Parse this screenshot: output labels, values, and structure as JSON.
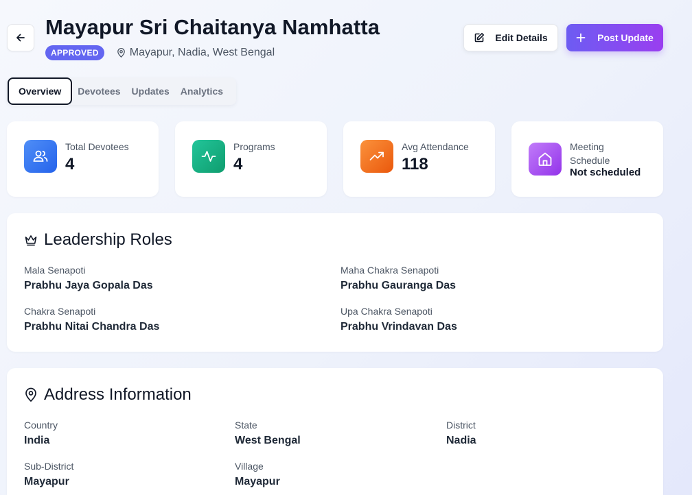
{
  "header": {
    "title": "Mayapur Sri Chaitanya Namhatta",
    "status": "APPROVED",
    "location": "Mayapur, Nadia, West Bengal",
    "edit_label": "Edit Details",
    "post_label": "Post Update"
  },
  "tabs": [
    {
      "label": "Overview"
    },
    {
      "label": "Devotees"
    },
    {
      "label": "Updates"
    },
    {
      "label": "Analytics"
    }
  ],
  "stats": [
    {
      "label": "Total Devotees",
      "value": "4",
      "icon": "users-icon"
    },
    {
      "label": "Programs",
      "value": "4",
      "icon": "activity-icon"
    },
    {
      "label": "Avg Attendance",
      "value": "118",
      "icon": "trending-up-icon"
    },
    {
      "label": "Meeting Schedule",
      "value": "Not scheduled",
      "icon": "home-icon"
    }
  ],
  "leadership": {
    "title": "Leadership Roles",
    "roles": [
      {
        "label": "Mala Senapoti",
        "value": "Prabhu Jaya Gopala Das"
      },
      {
        "label": "Maha Chakra Senapoti",
        "value": "Prabhu Gauranga Das"
      },
      {
        "label": "Chakra Senapoti",
        "value": "Prabhu Nitai Chandra Das"
      },
      {
        "label": "Upa Chakra Senapoti",
        "value": "Prabhu Vrindavan Das"
      }
    ]
  },
  "address": {
    "title": "Address Information",
    "fields": [
      {
        "label": "Country",
        "value": "India"
      },
      {
        "label": "State",
        "value": "West Bengal"
      },
      {
        "label": "District",
        "value": "Nadia"
      },
      {
        "label": "Sub-District",
        "value": "Mayapur"
      },
      {
        "label": "Village",
        "value": "Mayapur"
      }
    ]
  },
  "colors": {
    "accent": "#6366f1",
    "post_gradient_start": "#6d5cf2",
    "post_gradient_end": "#9a3ef0",
    "users": "#3b82f6",
    "programs": "#10b981",
    "attendance": "#f97316",
    "meeting": "#a855f7"
  }
}
